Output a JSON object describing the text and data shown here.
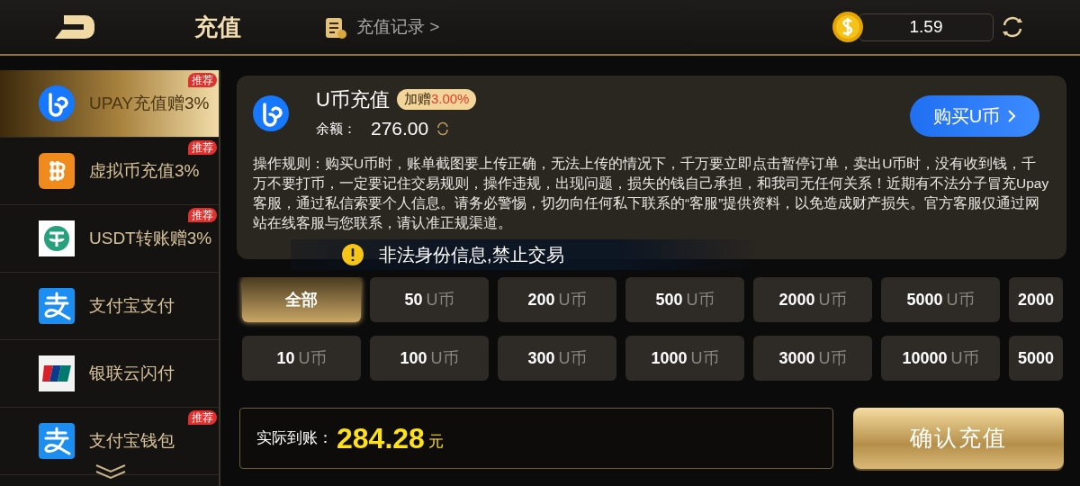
{
  "header": {
    "title": "充值",
    "records_link": "充值记录 >",
    "balance": "1.59"
  },
  "sidebar": {
    "items": [
      {
        "label": "UPAY充值赠3%",
        "selected": true,
        "badge": "推荐",
        "kind": "upay"
      },
      {
        "label": "虚拟币充值3%",
        "selected": false,
        "badge": "推荐",
        "kind": "bitcoin"
      },
      {
        "label": "USDT转账赠3%",
        "selected": false,
        "badge": "推荐",
        "kind": "usdt"
      },
      {
        "label": "支付宝支付",
        "selected": false,
        "kind": "alipay"
      },
      {
        "label": "银联云闪付",
        "selected": false,
        "kind": "unionpay"
      },
      {
        "label": "支付宝钱包",
        "selected": false,
        "badge": "推荐",
        "kind": "alipay"
      }
    ]
  },
  "card": {
    "title": "U币充值",
    "bonus_label": "加赠",
    "bonus_value": "3.00%",
    "balance_label": "余额：",
    "balance": "276.00",
    "buy_button": "购买U币",
    "rules": "操作规则：购买U币时，账单截图要上传正确，无法上传的情况下，千万要立即点击暂停订单，卖出U币时，没有收到钱，千万不要打币，一定要记住交易规则，操作违规，出现问题，损失的钱自己承担，和我司无任何关系！近期有不法分子冒充Upay客服，通过私信索要个人信息。请务必警惕，切勿向任何私下联系的“客服”提供资料，以免造成财产损失。官方客服仅通过网站在线客服与您联系，请认准正规渠道。"
  },
  "toast": {
    "message": "非法身份信息,禁止交易"
  },
  "amounts": [
    [
      {
        "value": "全部",
        "selected": true
      },
      {
        "value": "50",
        "unit": "U币",
        "selected": false
      },
      {
        "value": "200",
        "unit": "U币",
        "selected": false
      },
      {
        "value": "500",
        "unit": "U币",
        "selected": false
      },
      {
        "value": "2000",
        "unit": "U币",
        "selected": false
      },
      {
        "value": "5000",
        "unit": "U币",
        "selected": false
      },
      {
        "value": "2000",
        "selected": false
      }
    ],
    [
      {
        "value": "10",
        "unit": "U币",
        "selected": false
      },
      {
        "value": "100",
        "unit": "U币",
        "selected": false
      },
      {
        "value": "300",
        "unit": "U币",
        "selected": false
      },
      {
        "value": "1000",
        "unit": "U币",
        "selected": false
      },
      {
        "value": "3000",
        "unit": "U币",
        "selected": false
      },
      {
        "value": "10000",
        "unit": "U币",
        "selected": false
      },
      {
        "value": "5000",
        "selected": false
      }
    ]
  ],
  "total": {
    "label": "实际到账：",
    "amount": "284.28",
    "currency": "元"
  },
  "confirm_button": "确认充值"
}
